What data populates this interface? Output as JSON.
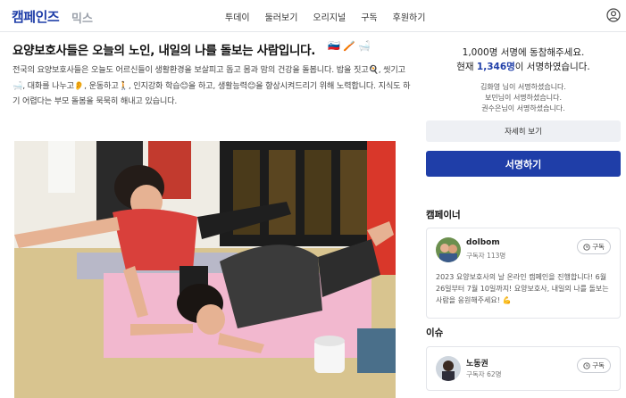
{
  "header": {
    "logo": "캠페인즈",
    "logo_sub": "믹스",
    "nav": [
      "투데이",
      "둘러보기",
      "오리지널",
      "구독",
      "후원하기"
    ],
    "user_icon": "user-circle-icon"
  },
  "article": {
    "title": "요양보호사들은 오늘의 노인, 내일의 나를 돌보는 사람입니다.",
    "title_emoji": "🇸🇮 🪥 🛁",
    "description": "전국의 요양보호사들은 오늘도 어르신들이 생활환경을 보살피고 돕고 몸과 맘의 건강을 돌봅니다. 밥을 짓고🍳, 씻기고🛁, 대화를 나누고👂, 운동하고🚶, 인지강화 학습😊을 하고, 생활능력😊을 향상시켜드리기 위해 노력합니다. 지식도 하기 어렵다는 부모 돌봄을 묵묵히 해내고 있습니다.",
    "photo_alt": "photo"
  },
  "campaign": {
    "goal_text": "1,000명 서명에 동참해주세요.",
    "count_prefix": "현재 ",
    "count_value": "1,346명",
    "count_suffix": "이 서명하였습니다.",
    "signers": [
      "김화영 님이 서명하셨습니다.",
      "보민님이 서명하셨습니다.",
      "권수은님이 서명하셨습니다."
    ],
    "more_label": "자세히 보기",
    "sign_label": "서명하기"
  },
  "campaigner": {
    "section_label": "캠페이너",
    "name": "dolbom",
    "subscribers": "구독자 113명",
    "subscribe_label": "구독",
    "body": "2023 요양보호사의 날 온라인 캠페인을 진행합니다! 6월 26일부터 7월 10일까지! 요양보호사, 내일의 나를 돌보는 사람을 응원해주세요! 💪"
  },
  "issue": {
    "section_label": "이슈",
    "name": "노동권",
    "subscribers": "구독자 62명",
    "subscribe_label": "구독"
  },
  "colors": {
    "brand": "#1f3ea8",
    "button_gray": "#eef0f4"
  }
}
